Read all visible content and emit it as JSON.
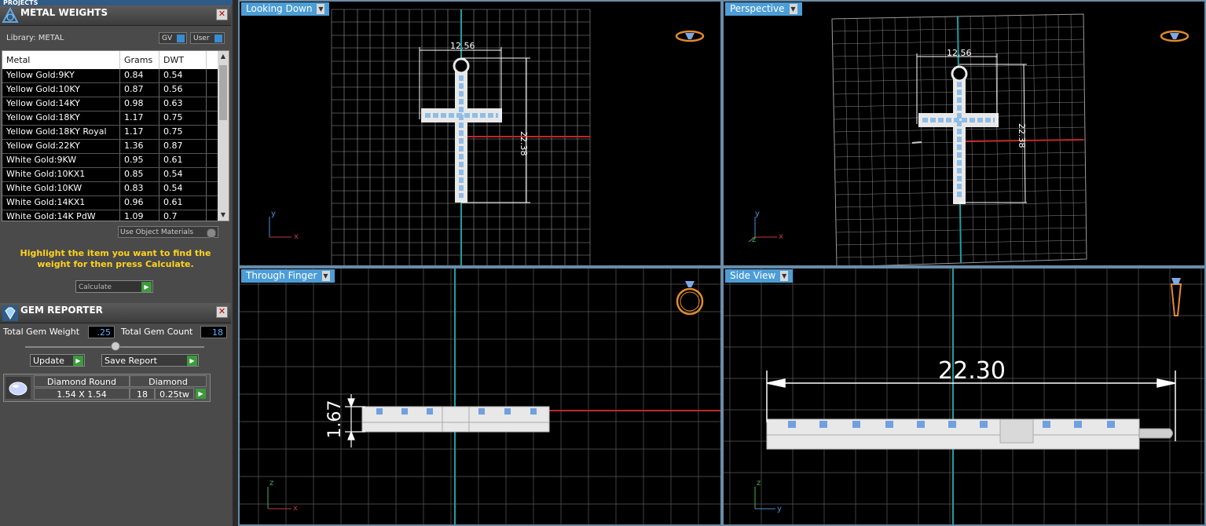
{
  "projects_label": "PROJECTS",
  "metal_weights": {
    "title": "METAL WEIGHTS",
    "library": "Library: METAL",
    "gv": "GV",
    "user": "User",
    "headers": [
      "Metal",
      "Grams",
      "DWT"
    ],
    "rows": [
      [
        "Yellow Gold:9KY",
        "0.84",
        "0.54"
      ],
      [
        "Yellow Gold:10KY",
        "0.87",
        "0.56"
      ],
      [
        "Yellow Gold:14KY",
        "0.98",
        "0.63"
      ],
      [
        "Yellow Gold:18KY",
        "1.17",
        "0.75"
      ],
      [
        "Yellow Gold:18KY Royal",
        "1.17",
        "0.75"
      ],
      [
        "Yellow Gold:22KY",
        "1.36",
        "0.87"
      ],
      [
        "White Gold:9KW",
        "0.95",
        "0.61"
      ],
      [
        "White Gold:10KX1",
        "0.85",
        "0.54"
      ],
      [
        "White Gold:10KW",
        "0.83",
        "0.54"
      ],
      [
        "White Gold:14KX1",
        "0.96",
        "0.61"
      ],
      [
        "White Gold:14K PdW",
        "1.09",
        "0.7"
      ]
    ],
    "use_object_materials": "Use Object Materials",
    "hint": "Highlight the item you want to find the weight for then press Calculate.",
    "calculate": "Calculate"
  },
  "gem_reporter": {
    "title": "GEM REPORTER",
    "total_weight_label": "Total Gem Weight",
    "total_weight": ".25",
    "total_count_label": "Total Gem Count",
    "total_count": "18",
    "update": "Update",
    "save_report": "Save Report",
    "gem": {
      "shape": "Diamond Round",
      "size": "1.54 X 1.54",
      "type": "Diamond",
      "count": "18",
      "weight": "0.25tw"
    }
  },
  "viewports": {
    "top_left": {
      "label": "Looking Down",
      "dim_w": "12.56",
      "dim_h": "22.38"
    },
    "top_right": {
      "label": "Perspective",
      "dim_w": "12.56",
      "dim_h": "22.38"
    },
    "bottom_left": {
      "label": "Through Finger",
      "dim": "1.67"
    },
    "bottom_right": {
      "label": "Side View",
      "dim": "22.30"
    }
  },
  "axes": {
    "x": "x",
    "y": "y",
    "z": "z"
  }
}
